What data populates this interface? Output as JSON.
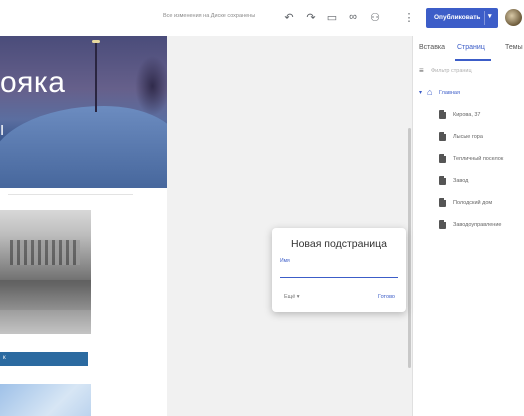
{
  "header": {
    "save_status": "Все изменения на Диске сохранены",
    "icons": [
      "undo-icon",
      "redo-icon",
      "preview-icon",
      "link-icon",
      "share-icon",
      "more-vert-icon"
    ],
    "publish_label": "Опубликовать",
    "publish_caret": "▾",
    "accent_color": "#3c5dc8"
  },
  "page_preview": {
    "hero_title": "ояка",
    "hero_subtitle": "І",
    "blue_bar_text": "к"
  },
  "sidebar": {
    "tabs": [
      {
        "label": "Вставка"
      },
      {
        "label": "Страниц"
      },
      {
        "label": "Темы"
      }
    ],
    "active_tab_index": 1,
    "filter_placeholder": "Фильтр страниц",
    "root_page": "Главная",
    "pages": [
      {
        "label": "Кирова, 37"
      },
      {
        "label": "Лысые гора"
      },
      {
        "label": "Тепличный поселок"
      },
      {
        "label": "Завод"
      },
      {
        "label": "Полодский дом"
      },
      {
        "label": "Заводоуправление"
      }
    ]
  },
  "dialog": {
    "title": "Новая подстраница",
    "field_label": "Имя",
    "field_value": "",
    "more_label": "Ещё ▾",
    "done_label": "Готово"
  }
}
